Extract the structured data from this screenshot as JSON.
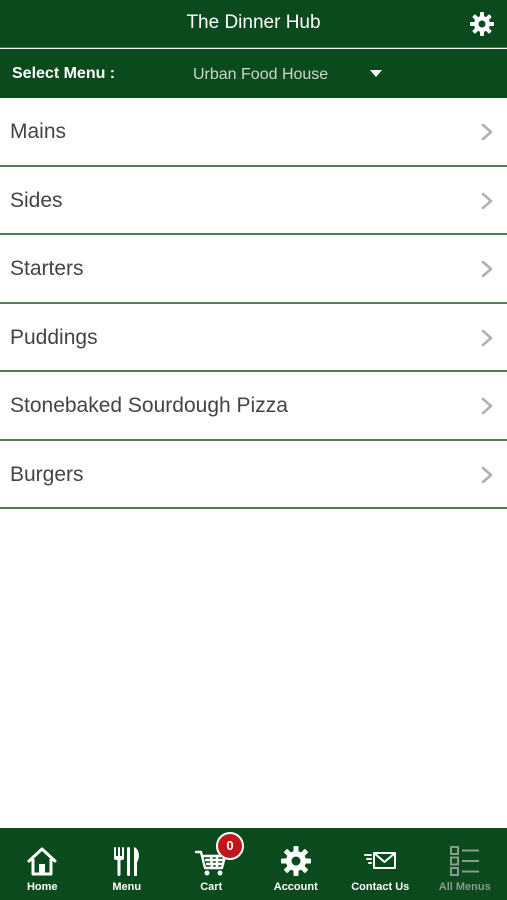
{
  "header": {
    "title": "The Dinner Hub",
    "settings_icon": "gear-icon"
  },
  "select_menu": {
    "label": "Select Menu :",
    "value": "Urban Food House"
  },
  "menu_items": [
    {
      "label": "Mains"
    },
    {
      "label": "Sides"
    },
    {
      "label": "Starters"
    },
    {
      "label": "Puddings"
    },
    {
      "label": "Stonebaked Sourdough Pizza"
    },
    {
      "label": "Burgers"
    }
  ],
  "tabbar": {
    "tabs": [
      {
        "label": "Home",
        "icon": "home-icon"
      },
      {
        "label": "Menu",
        "icon": "cutlery-icon"
      },
      {
        "label": "Cart",
        "icon": "cart-icon",
        "badge": "0"
      },
      {
        "label": "Account",
        "icon": "gear-icon"
      },
      {
        "label": "Contact Us",
        "icon": "mail-icon"
      },
      {
        "label": "All Menus",
        "icon": "list-icon"
      }
    ]
  },
  "colors": {
    "brand_green": "#0b4a1c",
    "badge_red": "#c0161c",
    "divider": "#4f7f58"
  }
}
